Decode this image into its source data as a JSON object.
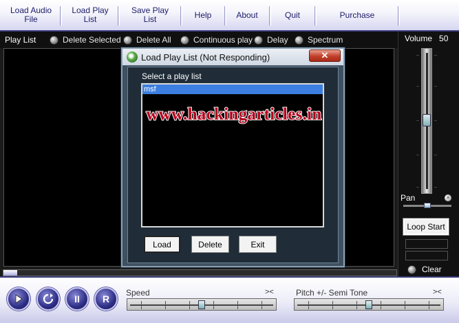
{
  "menu": {
    "items": [
      {
        "label": "Load Audio\nFile"
      },
      {
        "label": "Load Play\nList"
      },
      {
        "label": "Save Play\nList"
      },
      {
        "label": "Help"
      },
      {
        "label": "About"
      },
      {
        "label": "Quit"
      },
      {
        "label": "Purchase"
      }
    ]
  },
  "playlist_bar": {
    "title": "Play List",
    "options": [
      "Delete Selected",
      "Delete All",
      "Continuous play",
      "Delay",
      "Spectrum"
    ]
  },
  "right_panel": {
    "volume_label": "Volume",
    "volume_value": "50",
    "pan_label": "Pan",
    "loop_start_label": "Loop Start",
    "clear_label": "Clear"
  },
  "dialog": {
    "title": "Load Play List (Not Responding)",
    "close_symbol": "✕",
    "prompt": "Select a play list",
    "items": [
      "msf"
    ],
    "buttons": {
      "load": "Load",
      "delete": "Delete",
      "exit": "Exit"
    }
  },
  "watermark": "www.hackingarticles.in",
  "bottom": {
    "buttons": [
      "",
      "",
      "II",
      "R"
    ],
    "speed_label": "Speed",
    "speed_symbol": "><",
    "pitch_label": "Pitch +/- Semi Tone",
    "pitch_symbol": "><"
  },
  "colors": {
    "menu_text": "#1c1c6a",
    "dialog_body": "#3f5160",
    "selection": "#3d7fe0",
    "watermark": "#b3001b"
  }
}
